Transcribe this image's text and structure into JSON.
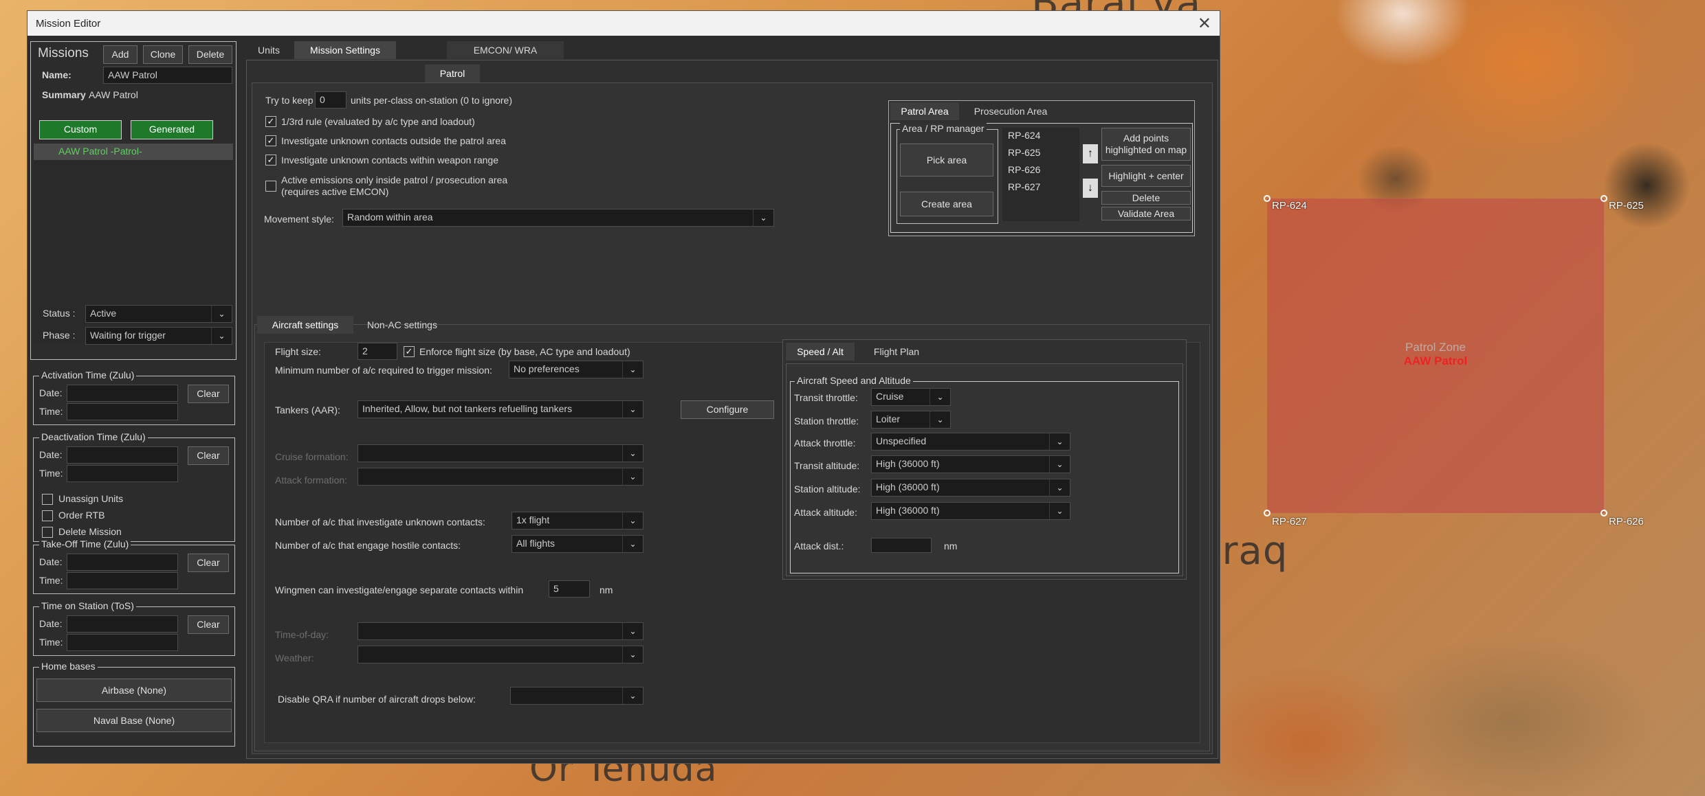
{
  "map": {
    "place_top": "Baraj ya",
    "place_iraq": "Iraq",
    "place_bottom": "Or Tenuda",
    "points": [
      "RP-624",
      "RP-625",
      "RP-627",
      "RP-626"
    ],
    "zone_label": "Patrol Zone",
    "zone_mission": "AAW Patrol",
    "zone_color": "#be4646"
  },
  "window": {
    "title": "Mission Editor",
    "close_icon": "close-icon"
  },
  "left": {
    "missions_label": "Missions",
    "add": "Add",
    "clone": "Clone",
    "delete": "Delete",
    "name_label": "Name:",
    "name_value": "AAW Patrol",
    "summary_label": "Summary",
    "summary_value": "AAW Patrol",
    "custom": "Custom",
    "generated": "Generated",
    "mission_item": "AAW Patrol  -Patrol-",
    "status_label": "Status :",
    "status_value": "Active",
    "phase_label": "Phase :",
    "phase_value": "Waiting for trigger",
    "activation": {
      "title": "Activation Time (Zulu)",
      "date": "Date:",
      "time": "Time:",
      "clear": "Clear"
    },
    "deactivation": {
      "title": "Deactivation Time (Zulu)",
      "date": "Date:",
      "time": "Time:",
      "clear": "Clear",
      "unassign": "Unassign Units",
      "order_rtb": "Order RTB",
      "delete_mission": "Delete Mission"
    },
    "takeoff": {
      "title": "Take-Off Time (Zulu)",
      "date": "Date:",
      "time": "Time:",
      "clear": "Clear"
    },
    "tos": {
      "title": "Time on Station (ToS)",
      "date": "Date:",
      "time": "Time:",
      "clear": "Clear"
    },
    "home": {
      "title": "Home bases",
      "airbase": "Airbase (None)",
      "naval": "Naval Base (None)"
    }
  },
  "tabs": {
    "units": "Units",
    "mission_settings": "Mission Settings",
    "emcon": "EMCON/ WRA",
    "patrol": "Patrol"
  },
  "patrol": {
    "keep_pre": "Try to keep",
    "keep_value": "0",
    "keep_post": "units per-class on-station (0 to ignore)",
    "rule_third": "1/3rd rule (evaluated by a/c type and loadout)",
    "investigate_outside": "Investigate unknown contacts outside the patrol area",
    "investigate_within": "Investigate unknown contacts within weapon range",
    "active_emissions_1": "Active emissions only inside patrol / prosecution area",
    "active_emissions_2": "(requires active EMCON)",
    "movement_label": "Movement style:",
    "movement_value": "Random within area",
    "area_tabs": {
      "patrol_area": "Patrol Area",
      "prosecution_area": "Prosecution Area"
    },
    "rp_manager": "Area / RP manager",
    "pick_area": "Pick area",
    "create_area": "Create area",
    "rp_list": [
      "RP-624",
      "RP-625",
      "RP-626",
      "RP-627"
    ],
    "add_points_1": "Add points",
    "add_points_2": "highlighted on map",
    "highlight_center": "Highlight + center",
    "delete": "Delete",
    "validate": "Validate Area"
  },
  "aircraft": {
    "tabs": {
      "aircraft_settings": "Aircraft settings",
      "non_ac": "Non-AC settings"
    },
    "flight_size_label": "Flight size:",
    "flight_size_value": "2",
    "enforce": "Enforce flight size (by base, AC type and loadout)",
    "min_label": "Minimum number of a/c required to trigger mission:",
    "min_value": "No preferences",
    "tankers_label": "Tankers (AAR):",
    "tankers_value": "Inherited, Allow, but not tankers refuelling tankers",
    "configure": "Configure",
    "cruise_label": "Cruise formation:",
    "attack_form_label": "Attack formation:",
    "investigate_label": "Number of a/c that investigate unknown contacts:",
    "investigate_value": "1x flight",
    "engage_label": "Number of a/c that engage hostile contacts:",
    "engage_value": "All flights",
    "wingmen_label": "Wingmen can investigate/engage separate contacts within",
    "wingmen_value": "5",
    "wingmen_unit": "nm",
    "tod_label": "Time-of-day:",
    "weather_label": "Weather:",
    "qra_label": "Disable QRA if number of aircraft drops below:",
    "speed_tabs": {
      "speed_alt": "Speed / Alt",
      "flight_plan": "Flight Plan"
    },
    "speed_group": "Aircraft Speed and Altitude",
    "transit_throttle_label": "Transit throttle:",
    "transit_throttle_value": "Cruise",
    "station_throttle_label": "Station throttle:",
    "station_throttle_value": "Loiter",
    "attack_throttle_label": "Attack throttle:",
    "attack_throttle_value": "Unspecified",
    "transit_alt_label": "Transit altitude:",
    "transit_alt_value": "High (36000 ft)",
    "station_alt_label": "Station altitude:",
    "station_alt_value": "High (36000 ft)",
    "attack_alt_label": "Attack altitude:",
    "attack_alt_value": "High (36000 ft)",
    "attack_dist_label": "Attack dist.:",
    "attack_dist_unit": "nm"
  }
}
